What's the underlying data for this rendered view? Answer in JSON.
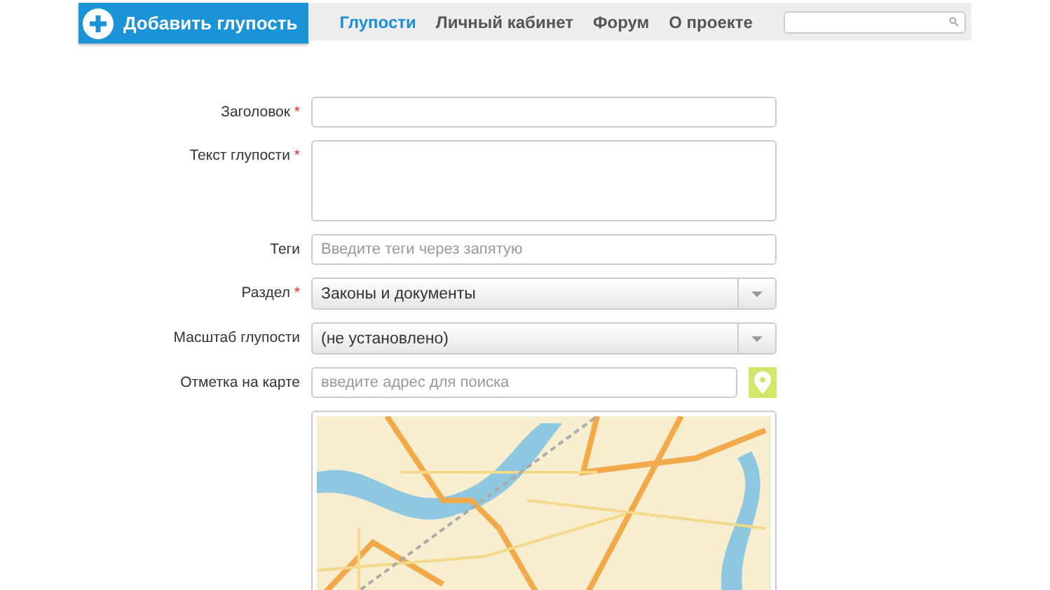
{
  "add_button": {
    "label": "Добавить глупость"
  },
  "nav": [
    {
      "label": "Глупости",
      "selected": true
    },
    {
      "label": "Личный кабинет",
      "selected": false
    },
    {
      "label": "Форум",
      "selected": false
    },
    {
      "label": "О проекте",
      "selected": false
    }
  ],
  "fields": [
    {
      "kind": "text",
      "label": "Заголовок",
      "required_mark": "*"
    },
    {
      "kind": "textarea",
      "label": "Текст глупости",
      "required_mark": "*"
    },
    {
      "kind": "text",
      "label": "Теги",
      "placeholder": "Введите теги через запятую"
    },
    {
      "kind": "select",
      "label": "Раздел",
      "required_mark": "*",
      "value": "Законы и документы"
    },
    {
      "kind": "select",
      "label": "Масштаб глупости",
      "value": "(не установлено)"
    },
    {
      "kind": "location",
      "label": "Отметка на карте",
      "placeholder": "введите адрес для поиска"
    }
  ]
}
